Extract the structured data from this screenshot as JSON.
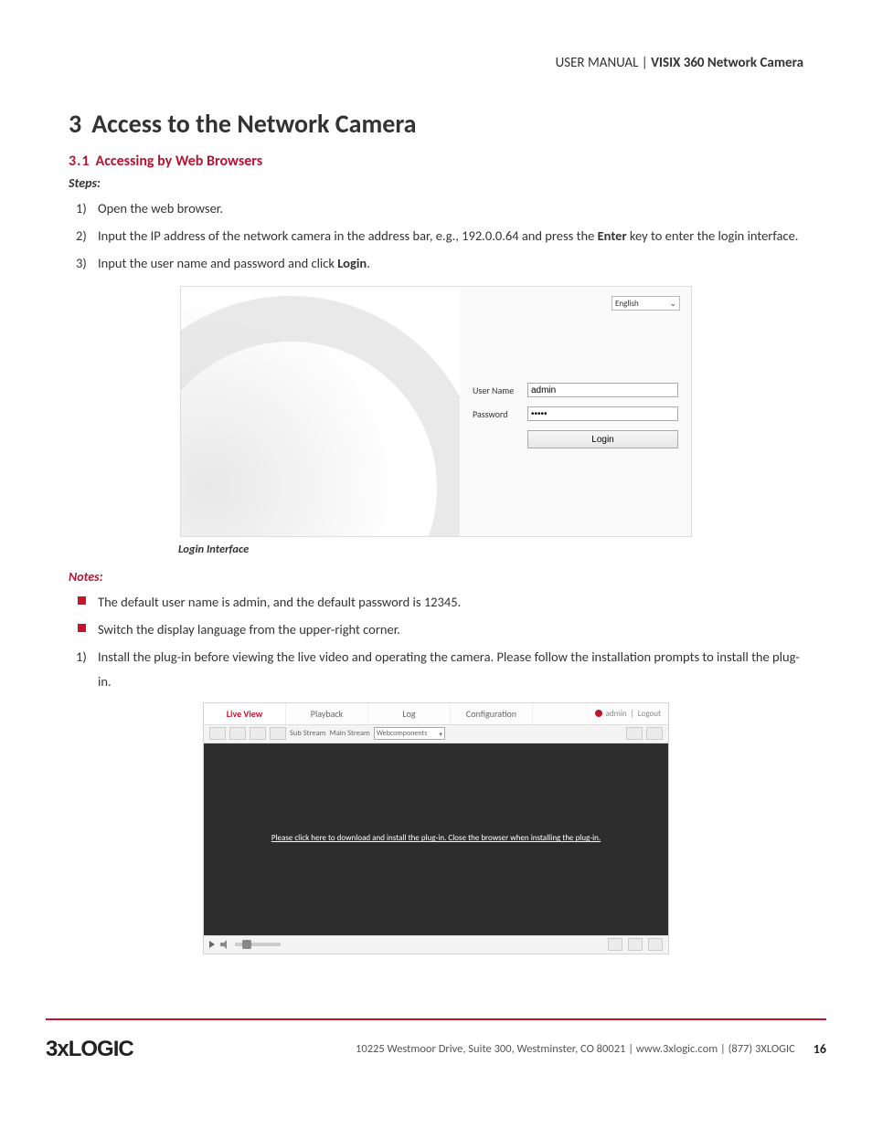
{
  "header": {
    "left": "USER MANUAL | ",
    "title_bold": "VISIX 360 Network Camera"
  },
  "chapter": {
    "num": "3",
    "title": "Access to the Network Camera"
  },
  "section": {
    "num": "3.1",
    "title": "Accessing by Web Browsers"
  },
  "steps_label": "Steps:",
  "steps": {
    "s1": {
      "n": "1)",
      "text": "Open the web browser."
    },
    "s2": {
      "n": "2)",
      "pre": "Input the IP address of the network camera in the address bar, e.g., 192.0.0.64 and press the ",
      "bold": "Enter",
      "post": " key to enter the login interface."
    },
    "s3": {
      "n": "3)",
      "pre": "Input the user name and password and click ",
      "bold": "Login",
      "post": "."
    }
  },
  "login_shot": {
    "lang": "English",
    "user_label": "User Name",
    "user_value": "admin",
    "pass_label": "Password",
    "pass_value": "•••••",
    "login_btn": "Login"
  },
  "caption1": "Login Interface",
  "notes_label": "Notes:",
  "notes": {
    "n1": "The default user name is admin, and the default password is 12345.",
    "n2": "Switch the display language from the upper-right corner.",
    "n3": {
      "n": "1)",
      "text": "Install the plug-in before viewing the live video and operating the camera. Please follow the installation prompts to install the plug-in."
    }
  },
  "liveview_shot": {
    "tabs": {
      "t1": "Live View",
      "t2": "Playback",
      "t3": "Log",
      "t4": "Configuration"
    },
    "user": "admin",
    "logout": "Logout",
    "toolbar": {
      "sub": "Sub Stream",
      "main": "Main Stream",
      "comp": "Webcomponents"
    },
    "plugin_msg": "Please click here to download and install the plug-in. Close the browser when installing the plug-in."
  },
  "footer": {
    "logo": "3xLOGIC",
    "text": "10225 Westmoor Drive, Suite 300, Westminster, CO 80021 | www.3xlogic.com | (877) 3XLOGIC",
    "page": "16"
  }
}
